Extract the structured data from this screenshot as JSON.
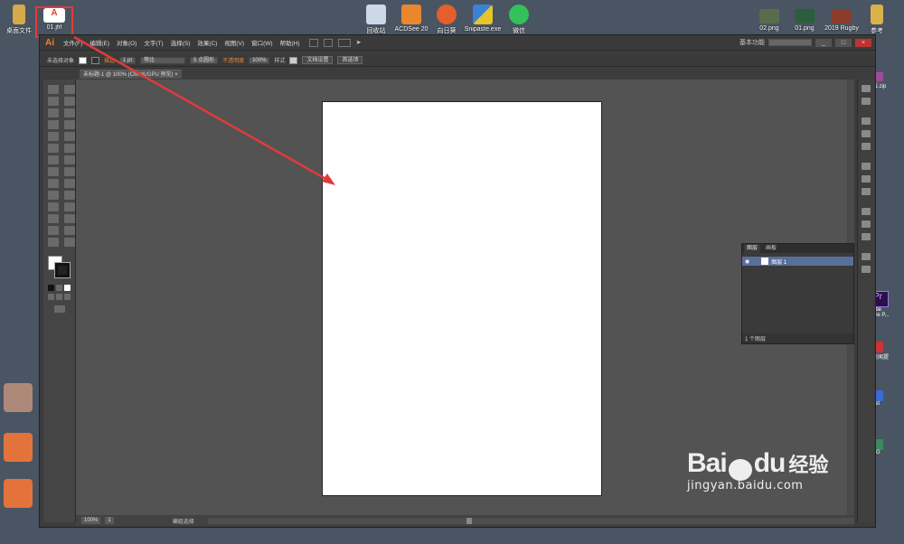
{
  "desktop": {
    "icons_top": [
      {
        "label": "桌面文件",
        "color": "#d6a94b"
      },
      {
        "label": "01.jfif",
        "color": "#ffffff"
      },
      {
        "label": "回收站",
        "color": "#cdd8e6"
      },
      {
        "label": "ACDSee 20",
        "color": "#e9872c"
      },
      {
        "label": "向日葵",
        "color": "#e45f2b"
      },
      {
        "label": "Snipaste.exe",
        "color": "#3b82d6"
      },
      {
        "label": "微信",
        "color": "#33c15a"
      },
      {
        "label": "02.png",
        "color": "#5a6d4a"
      },
      {
        "label": "01.png",
        "color": "#2c5e3c"
      },
      {
        "label": "2019 Rugby",
        "color": "#8a3b2a"
      },
      {
        "label": "参考",
        "color": "#d9b24a"
      }
    ],
    "side_labels": [
      "版.zip",
      "obe",
      "ere P...",
      "新闻提",
      "F",
      "ost",
      "EG"
    ]
  },
  "window": {
    "logo": "Ai",
    "menu": [
      "文件(F)",
      "编辑(E)",
      "对象(O)",
      "文字(T)",
      "选择(S)",
      "效果(C)",
      "视图(V)",
      "窗口(W)",
      "帮助(H)"
    ],
    "workspace": "基本功能",
    "win_buttons": [
      "_",
      "□",
      "×"
    ]
  },
  "control_bar": {
    "selection": "未选择对象",
    "stroke_label": "描边",
    "stroke_weight": "1 pt",
    "stroke_style": "等比",
    "brush": "5 点圆形",
    "opacity_label": "不透明度",
    "opacity_value": "100%",
    "style_label": "样式",
    "doc_settings": "文档设置",
    "preferences": "首选项"
  },
  "document_tab": {
    "title": "未标题-1 @ 100% (CMYK/GPU 预览)"
  },
  "status_bar": {
    "zoom": "100%",
    "page": "1",
    "tool_name": "编组选择"
  },
  "layers_panel": {
    "tabs": [
      "图层",
      "画板"
    ],
    "layer_name": "图层 1",
    "footer": "1 个图层"
  },
  "watermark": {
    "brand": "Bai",
    "brand_tail": "du",
    "cn": "经验",
    "url": "jingyan.baidu.com"
  },
  "colors": {
    "highlight": "#e23a3a",
    "arrow": "#e23a3a",
    "desktop_bg": "#4a5563"
  }
}
